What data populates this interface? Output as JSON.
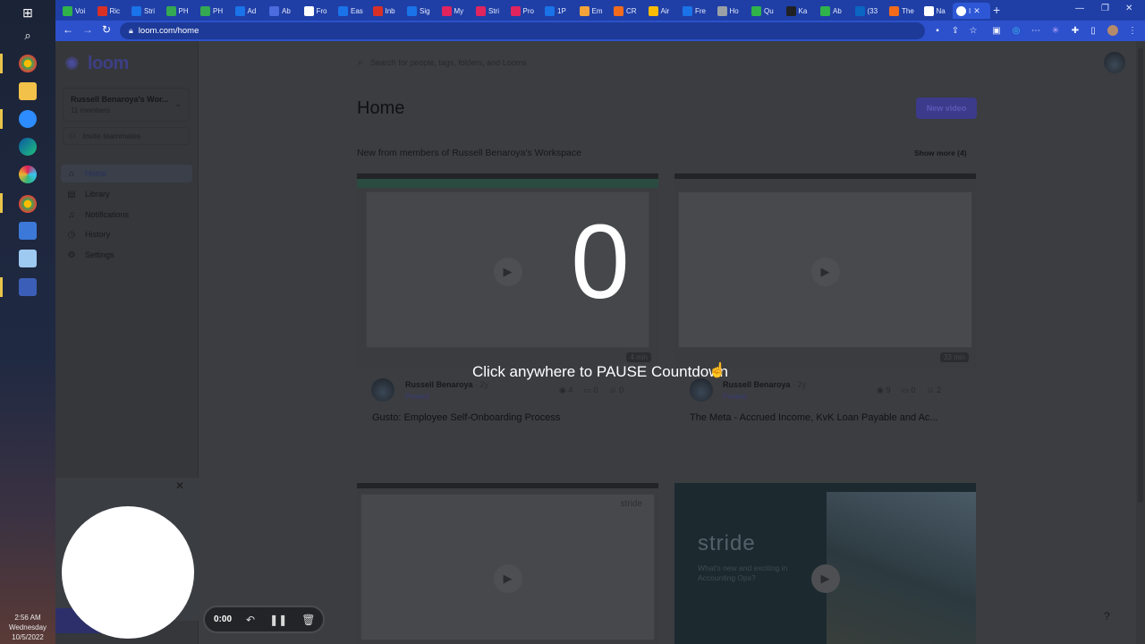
{
  "taskbar": {
    "clock": {
      "time": "2:56 AM",
      "day": "Wednesday",
      "date": "10/5/2022"
    }
  },
  "browser": {
    "tabs": [
      {
        "label": "Voi",
        "color": "#2fb34a"
      },
      {
        "label": "Ric",
        "color": "#d93025"
      },
      {
        "label": "Stri",
        "color": "#1a73e8"
      },
      {
        "label": "PH",
        "color": "#34a853"
      },
      {
        "label": "PH",
        "color": "#34a853"
      },
      {
        "label": "Ad",
        "color": "#1a73e8"
      },
      {
        "label": "Ab",
        "color": "#4b6bde"
      },
      {
        "label": "Fro",
        "color": "#ffffff"
      },
      {
        "label": "Eas",
        "color": "#1a73e8"
      },
      {
        "label": "Inb",
        "color": "#d93025"
      },
      {
        "label": "Sig",
        "color": "#1a73e8"
      },
      {
        "label": "My",
        "color": "#e0245e"
      },
      {
        "label": "Stri",
        "color": "#e0245e"
      },
      {
        "label": "Pro",
        "color": "#e0245e"
      },
      {
        "label": "1P",
        "color": "#1a73e8"
      },
      {
        "label": "Em",
        "color": "#f2a33a"
      },
      {
        "label": "CR",
        "color": "#f26b1d"
      },
      {
        "label": "Air",
        "color": "#fbbc04"
      },
      {
        "label": "Fre",
        "color": "#1a73e8"
      },
      {
        "label": "Ho",
        "color": "#9aa0a6"
      },
      {
        "label": "Qu",
        "color": "#2fb34a"
      },
      {
        "label": "Ka",
        "color": "#202124"
      },
      {
        "label": "Ab",
        "color": "#2fb34a"
      },
      {
        "label": "(33",
        "color": "#0a66c2"
      },
      {
        "label": "The",
        "color": "#f26b1d"
      },
      {
        "label": "Na",
        "color": "#ffffff"
      }
    ],
    "active_tab": {
      "label": "I",
      "color": "#d93025"
    },
    "url": "loom.com/home"
  },
  "loom": {
    "brand": "loom",
    "workspace": {
      "name": "Russell Benaroya's Wor...",
      "members": "11 members"
    },
    "invite_label": "Invite teammates",
    "nav": [
      {
        "label": "Home",
        "icon": "home-icon"
      },
      {
        "label": "Library",
        "icon": "library-icon"
      },
      {
        "label": "Notifications",
        "icon": "bell-icon"
      },
      {
        "label": "History",
        "icon": "history-icon"
      },
      {
        "label": "Settings",
        "icon": "gear-icon"
      }
    ],
    "search_placeholder": "Search for people, tags, folders, and Looms",
    "page_title": "Home",
    "new_video_label": "New video",
    "section_title": "New from members of Russell Benaroya's Workspace",
    "show_more": "Show more (4)",
    "videos": [
      {
        "author": "Russell Benaroya",
        "age": "· 2y",
        "status": "Posted",
        "views": "4",
        "comments": "0",
        "reactions": "0",
        "duration": "4 min",
        "title": "Gusto: Employee Self-Onboarding Process"
      },
      {
        "author": "Russell Benaroya",
        "age": "· 2y",
        "status": "Posted",
        "views": "9",
        "comments": "0",
        "reactions": "2",
        "duration": "33 min",
        "title": "The Meta - Accrued Income, KvK Loan Payable and Ac..."
      }
    ],
    "thumb3_brand": "stride",
    "thumb4_brand": "stride",
    "thumb4_tagline": "What's new and exciting in Accounting Ops?",
    "help_label": "?"
  },
  "recorder": {
    "countdown": "0",
    "pause_hint": "Click anywhere to PAUSE Countdown",
    "timer": "0:00"
  }
}
